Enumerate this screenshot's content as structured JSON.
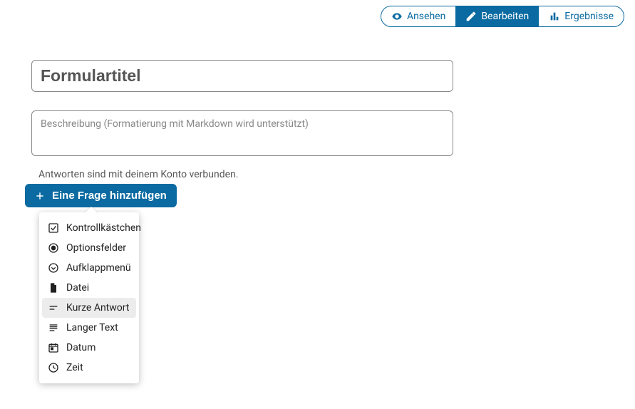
{
  "tabs": {
    "view": "Ansehen",
    "edit": "Bearbeiten",
    "results": "Ergebnisse"
  },
  "form": {
    "title_placeholder": "Formulartitel",
    "desc_placeholder": "Beschreibung (Formatierung mit Markdown wird unterstützt)",
    "hint": "Antworten sind mit deinem Konto verbunden."
  },
  "add_button": "Eine Frage hinzufügen",
  "menu": {
    "checkbox": "Kontrollkästchen",
    "radio": "Optionsfelder",
    "dropdown": "Aufklappmenü",
    "file": "Datei",
    "short": "Kurze Antwort",
    "long": "Langer Text",
    "date": "Datum",
    "time": "Zeit"
  }
}
